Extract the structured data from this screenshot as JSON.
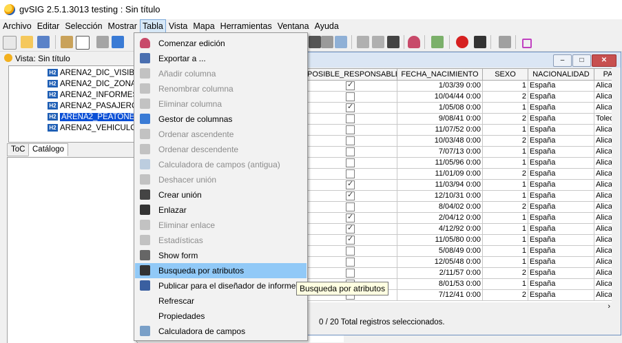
{
  "app": {
    "title": "gvSIG 2.5.1.3013 testing : Sin título"
  },
  "menubar": [
    "Archivo",
    "Editar",
    "Selección",
    "Mostrar",
    "Tabla",
    "Vista",
    "Mapa",
    "Herramientas",
    "Ventana",
    "Ayuda"
  ],
  "view": {
    "title": "Vista: Sin título",
    "layers": [
      "ARENA2_DIC_VISIBILI",
      "ARENA2_DIC_ZONA",
      "ARENA2_INFORMES",
      "ARENA2_PASAJEROS",
      "ARENA2_PEATONES",
      "ARENA2_VEHICULOS"
    ],
    "layer_badge": "H2",
    "selected_layer": "ARENA2_PEATONES",
    "tabs": [
      "ToC",
      "Catálogo"
    ]
  },
  "table": {
    "columns": [
      "POSIBLE_RESPONSABLE",
      "FECHA_NACIMIENTO",
      "SEXO",
      "NACIONALIDAD",
      "PA"
    ],
    "rows": [
      {
        "resp": true,
        "fecha": "1/03/39 0:00",
        "sexo": "1",
        "nac": "España",
        "pa": "Alica"
      },
      {
        "resp": false,
        "fecha": "10/04/44 0:00",
        "sexo": "2",
        "nac": "España",
        "pa": "Alica"
      },
      {
        "resp": true,
        "fecha": "1/05/08 0:00",
        "sexo": "1",
        "nac": "España",
        "pa": "Alica"
      },
      {
        "resp": false,
        "fecha": "9/08/41 0:00",
        "sexo": "2",
        "nac": "España",
        "pa": "Toled"
      },
      {
        "resp": false,
        "fecha": "11/07/52 0:00",
        "sexo": "1",
        "nac": "España",
        "pa": "Alica"
      },
      {
        "resp": false,
        "fecha": "10/03/48 0:00",
        "sexo": "2",
        "nac": "España",
        "pa": "Alica"
      },
      {
        "resp": false,
        "fecha": "7/07/13 0:00",
        "sexo": "1",
        "nac": "España",
        "pa": "Alica"
      },
      {
        "resp": false,
        "fecha": "11/05/96 0:00",
        "sexo": "1",
        "nac": "España",
        "pa": "Alica"
      },
      {
        "resp": false,
        "fecha": "11/01/09 0:00",
        "sexo": "2",
        "nac": "España",
        "pa": "Alica"
      },
      {
        "resp": true,
        "fecha": "11/03/94 0:00",
        "sexo": "1",
        "nac": "España",
        "pa": "Alica"
      },
      {
        "resp": true,
        "fecha": "12/10/31 0:00",
        "sexo": "1",
        "nac": "España",
        "pa": "Alica"
      },
      {
        "resp": false,
        "fecha": "8/04/02 0:00",
        "sexo": "2",
        "nac": "España",
        "pa": "Alica"
      },
      {
        "resp": true,
        "fecha": "2/04/12 0:00",
        "sexo": "1",
        "nac": "España",
        "pa": "Alica"
      },
      {
        "resp": true,
        "fecha": "4/12/92 0:00",
        "sexo": "1",
        "nac": "España",
        "pa": "Alica"
      },
      {
        "resp": true,
        "fecha": "11/05/80 0:00",
        "sexo": "1",
        "nac": "España",
        "pa": "Alica"
      },
      {
        "resp": false,
        "fecha": "5/08/49 0:00",
        "sexo": "1",
        "nac": "España",
        "pa": "Alica"
      },
      {
        "resp": false,
        "fecha": "12/05/48 0:00",
        "sexo": "1",
        "nac": "España",
        "pa": "Alica"
      },
      {
        "resp": false,
        "fecha": "2/11/57 0:00",
        "sexo": "2",
        "nac": "España",
        "pa": "Alica"
      },
      {
        "resp": false,
        "fecha": "8/01/53 0:00",
        "sexo": "1",
        "nac": "España",
        "pa": "Alica"
      },
      {
        "resp": true,
        "fecha": "7/12/41 0:00",
        "sexo": "2",
        "nac": "España",
        "pa": "Alica"
      }
    ],
    "status": "0 / 20 Total registros seleccionados."
  },
  "tabla_menu": [
    {
      "label": "Comenzar edición",
      "enabled": true,
      "icon": "database-icon"
    },
    {
      "label": "Exportar a ...",
      "enabled": true,
      "icon": "export-icon"
    },
    {
      "label": "Añadir columna",
      "enabled": false,
      "icon": "add-column-icon"
    },
    {
      "label": "Renombrar columna",
      "enabled": false,
      "icon": "rename-column-icon"
    },
    {
      "label": "Eliminar columna",
      "enabled": false,
      "icon": "delete-column-icon"
    },
    {
      "label": "Gestor de columnas",
      "enabled": true,
      "icon": "column-manager-icon"
    },
    {
      "label": "Ordenar ascendente",
      "enabled": false,
      "icon": "sort-ascending-icon"
    },
    {
      "label": "Ordenar descendente",
      "enabled": false,
      "icon": "sort-descending-icon"
    },
    {
      "label": "Calculadora de campos (antigua)",
      "enabled": false,
      "icon": "calculator-icon"
    },
    {
      "label": "Deshacer unión",
      "enabled": false,
      "icon": "undo-join-icon"
    },
    {
      "label": "Crear unión",
      "enabled": true,
      "icon": "join-icon"
    },
    {
      "label": "Enlazar",
      "enabled": true,
      "icon": "link-icon"
    },
    {
      "label": "Eliminar enlace",
      "enabled": false,
      "icon": "unlink-icon"
    },
    {
      "label": "Estadísticas",
      "enabled": false,
      "icon": "sigma-icon"
    },
    {
      "label": "Show form",
      "enabled": true,
      "icon": "form-icon"
    },
    {
      "label": "Busqueda por atributos",
      "enabled": true,
      "icon": "binoculars-icon",
      "highlighted": true
    },
    {
      "label": "Publicar para el diseñador de informes",
      "enabled": true,
      "icon": "publish-icon"
    },
    {
      "label": "Refrescar",
      "enabled": true,
      "icon": ""
    },
    {
      "label": "Propiedades",
      "enabled": true,
      "icon": ""
    },
    {
      "label": "Calculadora de campos",
      "enabled": true,
      "icon": "calculator-icon"
    }
  ],
  "tooltip": "Busqueda por atributos",
  "colors": {
    "menu_highlight": "#91c9f7",
    "selection": "#0a4fd6",
    "layer_badge": "#1f5fb5"
  }
}
